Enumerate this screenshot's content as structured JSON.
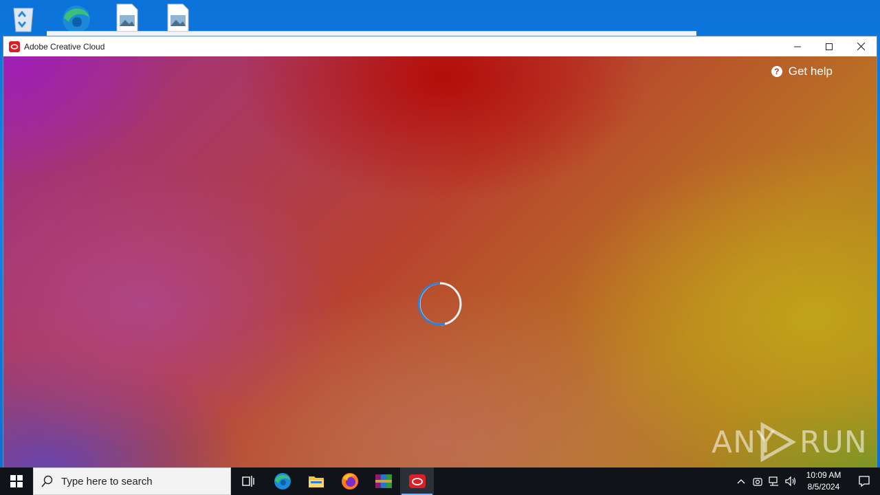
{
  "window": {
    "title": "Adobe Creative Cloud"
  },
  "content": {
    "help_label": "Get help",
    "watermark_left": "ANY",
    "watermark_right": "RUN"
  },
  "taskbar": {
    "search_placeholder": "Type here to search",
    "apps": [
      "task-view",
      "edge",
      "file-explorer",
      "firefox",
      "winrar",
      "creative-cloud"
    ],
    "active_app": "creative-cloud",
    "time": "10:09 AM",
    "date": "8/5/2024"
  },
  "colors": {
    "accent_blue": "#2f7fd8",
    "adobe_red": "#da1f26",
    "taskbar": "#101418"
  }
}
